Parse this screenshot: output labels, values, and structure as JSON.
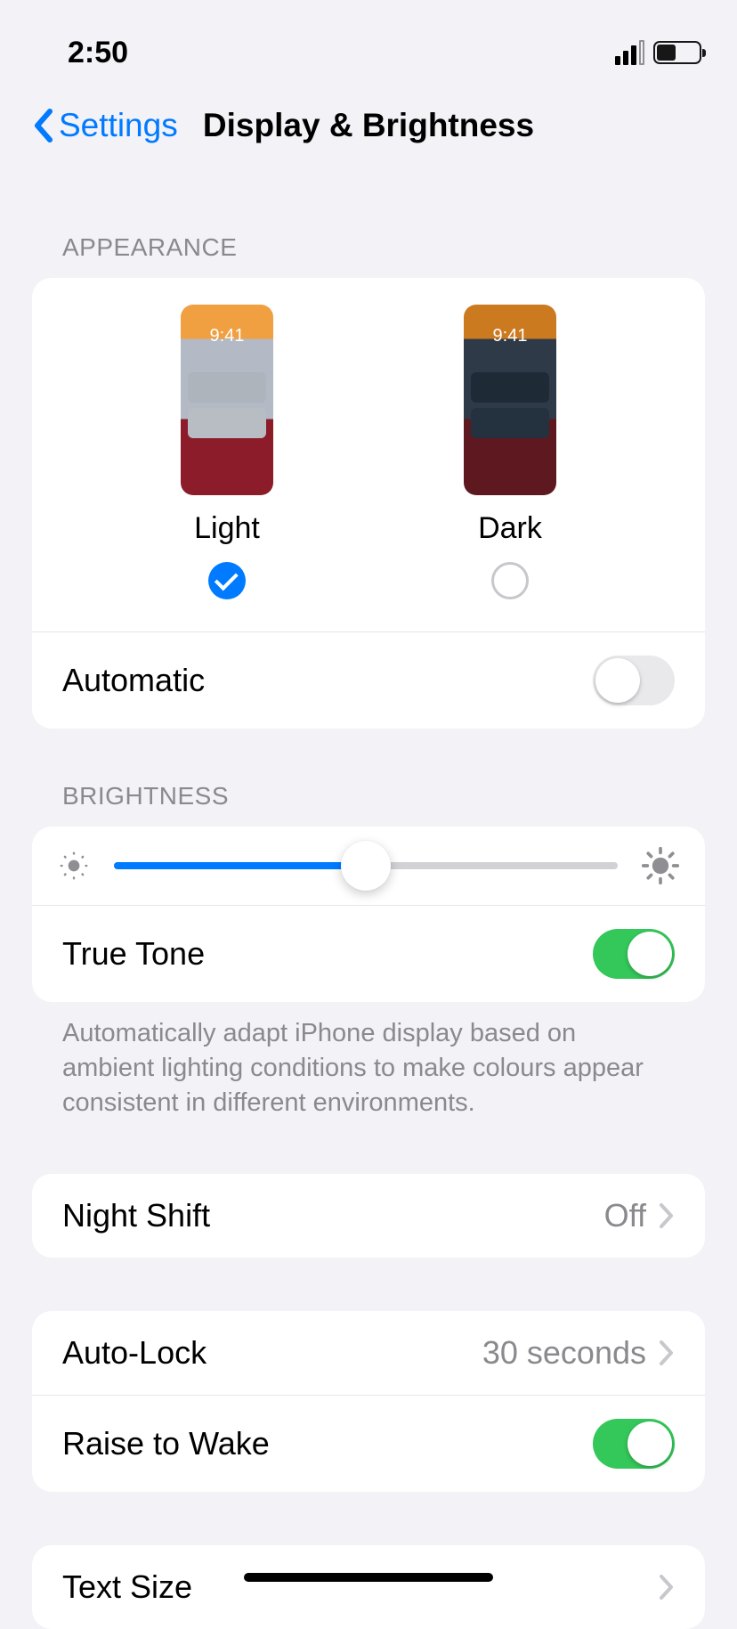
{
  "status": {
    "time": "2:50"
  },
  "nav": {
    "back": "Settings",
    "title": "Display & Brightness"
  },
  "appearance": {
    "header": "APPEARANCE",
    "light_label": "Light",
    "dark_label": "Dark",
    "preview_time": "9:41",
    "automatic_label": "Automatic",
    "automatic_on": false,
    "selected": "light"
  },
  "brightness": {
    "header": "BRIGHTNESS",
    "value_percent": 50,
    "truetone_label": "True Tone",
    "truetone_on": true,
    "footer": "Automatically adapt iPhone display based on ambient lighting conditions to make colours appear consistent in different environments."
  },
  "night_shift": {
    "label": "Night Shift",
    "value": "Off"
  },
  "auto_lock": {
    "label": "Auto-Lock",
    "value": "30 seconds"
  },
  "raise_to_wake": {
    "label": "Raise to Wake",
    "on": true
  },
  "text_size": {
    "label": "Text Size"
  }
}
